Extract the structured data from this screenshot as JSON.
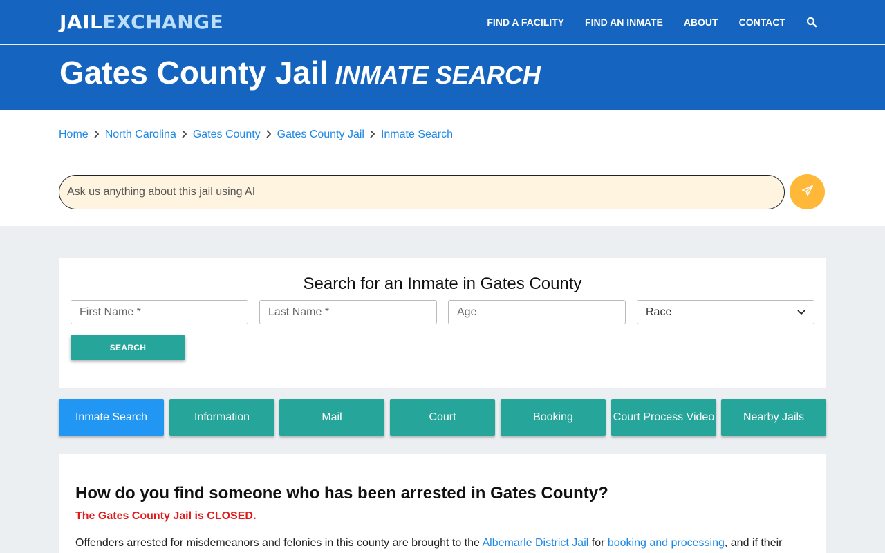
{
  "nav": {
    "logo_part1": "JAIL",
    "logo_part2": "EXCHANGE",
    "links": [
      "FIND A FACILITY",
      "FIND AN INMATE",
      "ABOUT",
      "CONTACT"
    ],
    "search_icon": "search-icon"
  },
  "hero": {
    "title": "Gates County Jail",
    "subtitle": "INMATE SEARCH"
  },
  "breadcrumb": [
    "Home",
    "North Carolina",
    "Gates County",
    "Gates County Jail",
    "Inmate Search"
  ],
  "ai": {
    "placeholder": "Ask us anything about this jail using AI",
    "send_icon": "paper-plane-icon"
  },
  "search": {
    "title": "Search for an Inmate in Gates County",
    "first_name_placeholder": "First Name *",
    "last_name_placeholder": "Last Name *",
    "age_placeholder": "Age",
    "race_selected": "Race",
    "button": "SEARCH"
  },
  "tabs": [
    "Inmate Search",
    "Information",
    "Mail",
    "Court",
    "Booking",
    "Court Process Video",
    "Nearby Jails"
  ],
  "content": {
    "question": "How do you find someone who has been arrested in Gates County?",
    "closed_notice": "The Gates County Jail is CLOSED.",
    "para_start": "Offenders arrested for misdemeanors and felonies in this county are brought to the ",
    "link1": "Albemarle District Jail",
    "para_mid": " for ",
    "link2": "booking and processing",
    "para_end": ", and if their"
  },
  "colors": {
    "primary": "#1565c0",
    "teal": "#26a69a",
    "active_tab": "#2196f3",
    "accent": "#ffb837",
    "alert": "#e01b1b"
  }
}
